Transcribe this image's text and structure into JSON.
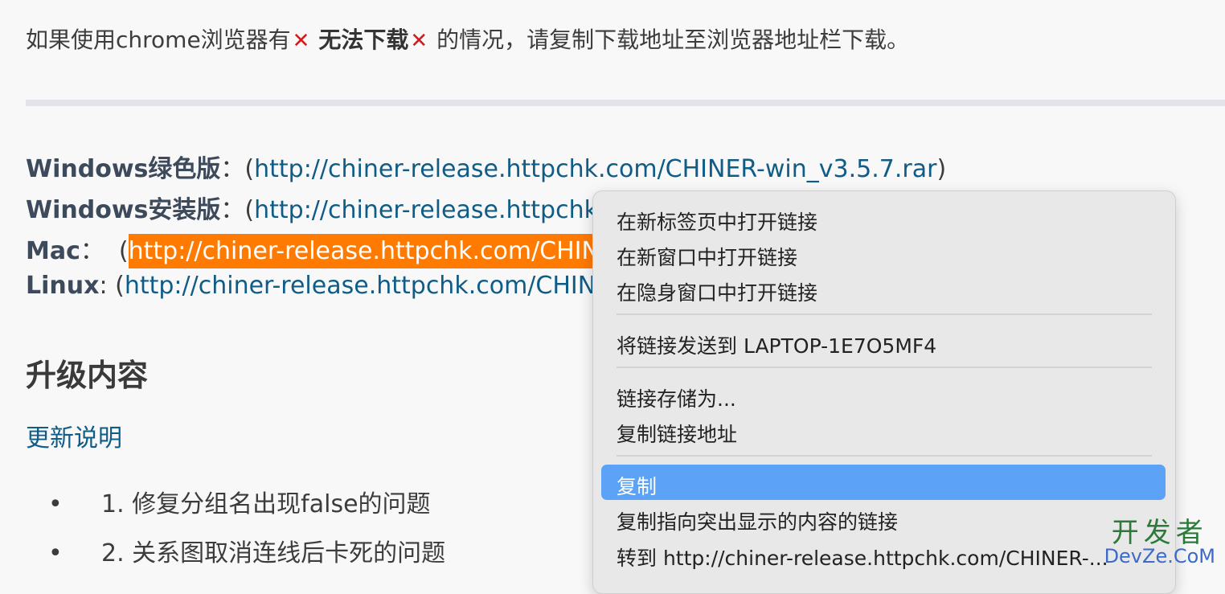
{
  "notice": {
    "prefix": "如果使用chrome浏览器有",
    "x": "✕",
    "middle": "无法下载",
    "suffix": "的情况，请复制下载地址至浏览器地址栏下载。"
  },
  "downloads": [
    {
      "label": "Windows绿色版",
      "sep": "：",
      "open": "(",
      "url": "http://chiner-release.httpchk.com/CHINER-win_v3.5.7.rar",
      "close": ")"
    },
    {
      "label": "Windows安装版",
      "sep": "：",
      "open": "(",
      "url": "http://chiner-release.httpchk.c",
      "close": ""
    },
    {
      "label": "Mac",
      "sep": "：",
      "open": "(",
      "url": "http://chiner-release.httpchk.com/CHINE",
      "close": ""
    },
    {
      "label": "Linux",
      "sep": ": ",
      "open": "(",
      "url": "http://chiner-release.httpchk.com/CHINER",
      "close": ""
    }
  ],
  "section_title": "升级内容",
  "update_link": "更新说明",
  "list": [
    {
      "bullet": "•",
      "text": "1. 修复分组名出现false的问题"
    },
    {
      "bullet": "•",
      "text": "2. 关系图取消连线后卡死的问题"
    }
  ],
  "context_menu": {
    "items": [
      "在新标签页中打开链接",
      "在新窗口中打开链接",
      "在隐身窗口中打开链接",
      "将链接发送到 LAPTOP-1E7O5MF4",
      "链接存储为...",
      "复制链接地址",
      "复制",
      "复制指向突出显示的内容的链接",
      "转到 http://chiner-release.httpchk.com/CHINER-..."
    ],
    "selected_index": 6
  },
  "watermark": {
    "cn": "开发者",
    "en": "DevZe.CoM"
  },
  "colors": {
    "link": "#0f5c86",
    "highlight": "#ff7a00",
    "selected": "#5ca3f7",
    "x_mark": "#d11b1b"
  }
}
